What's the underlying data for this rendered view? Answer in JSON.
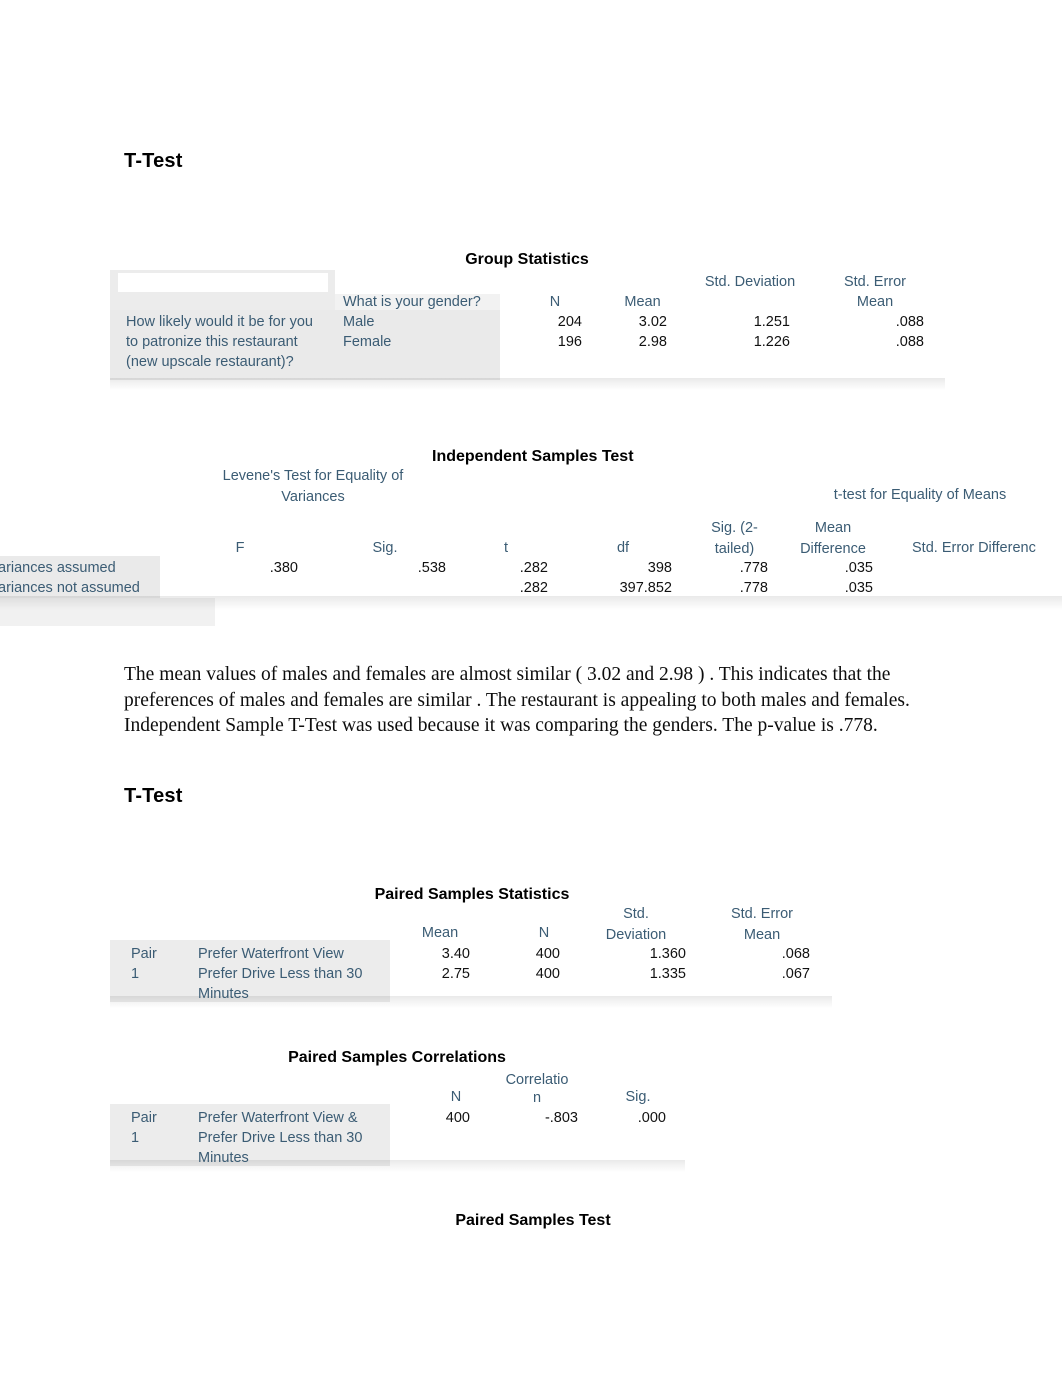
{
  "document": {
    "heading_1": "T-Test",
    "heading_2": "T-Test"
  },
  "group_statistics": {
    "title": "Group Statistics",
    "stub_label": "How likely would it be for you to patronize this restaurant (new upscale restaurant)?",
    "group_header": "What is your gender?",
    "columns": [
      "N",
      "Mean",
      "Std. Deviation",
      "Std. Error Mean"
    ],
    "rows": [
      {
        "group": "Male",
        "n": "204",
        "mean": "3.02",
        "sd": "1.251",
        "se": ".088"
      },
      {
        "group": "Female",
        "n": "196",
        "mean": "2.98",
        "sd": "1.226",
        "se": ".088"
      }
    ]
  },
  "independent_samples_test": {
    "title": "Independent Samples Test",
    "spanner_levene": "Levene's Test for Equality of Variances",
    "spanner_ttest": "t-test for Equality of Means",
    "columns": {
      "f": "F",
      "sig": "Sig.",
      "t": "t",
      "df": "df",
      "sig2": "Sig. (2-tailed)",
      "mean_diff": "Mean Difference",
      "se_diff": "Std. Error Differenc"
    },
    "rows": [
      {
        "label": "ariances assumed",
        "f": ".380",
        "sig": ".538",
        "t": ".282",
        "df": "398",
        "sig2": ".778",
        "mean_diff": ".035"
      },
      {
        "label": "ariances not assumed",
        "f": "",
        "sig": "",
        "t": ".282",
        "df": "397.852",
        "sig2": ".778",
        "mean_diff": ".035"
      }
    ]
  },
  "interpretation": {
    "text": "The mean values of males and females are almost similar ( 3.02 and 2.98 ) . This indicates that the preferences of males and females are similar . The restaurant is appealing to both males and females. Independent Sample T-Test was used because it was comparing the genders. The p-value is .778."
  },
  "paired_samples_statistics": {
    "title": "Paired Samples Statistics",
    "columns": [
      "Mean",
      "N",
      "Std. Deviation",
      "Std. Error Mean"
    ],
    "pair_label_line1": "Pair",
    "pair_label_line2": "1",
    "rows": [
      {
        "variable": "Prefer Waterfront View",
        "mean": "3.40",
        "n": "400",
        "sd": "1.360",
        "se": ".068"
      },
      {
        "variable": "Prefer Drive Less than 30 Minutes",
        "mean": "2.75",
        "n": "400",
        "sd": "1.335",
        "se": ".067"
      }
    ]
  },
  "paired_samples_correlations": {
    "title": "Paired Samples Correlations",
    "columns": [
      "N",
      "Correlation",
      "Sig."
    ],
    "correlation_header_line1": "Correlatio",
    "correlation_header_line2": "n",
    "pair_label_line1": "Pair",
    "pair_label_line2": "1",
    "rows": [
      {
        "variable": "Prefer Waterfront View & Prefer Drive Less than 30 Minutes",
        "n": "400",
        "correlation": "-.803",
        "sig": ".000"
      }
    ]
  },
  "paired_samples_test": {
    "title": "Paired Samples Test"
  },
  "colors": {
    "label_text": "#3b5c74",
    "value_text": "#111111",
    "heading_text": "#000000",
    "shade": "#d9d9d9",
    "page": "#ffffff"
  }
}
